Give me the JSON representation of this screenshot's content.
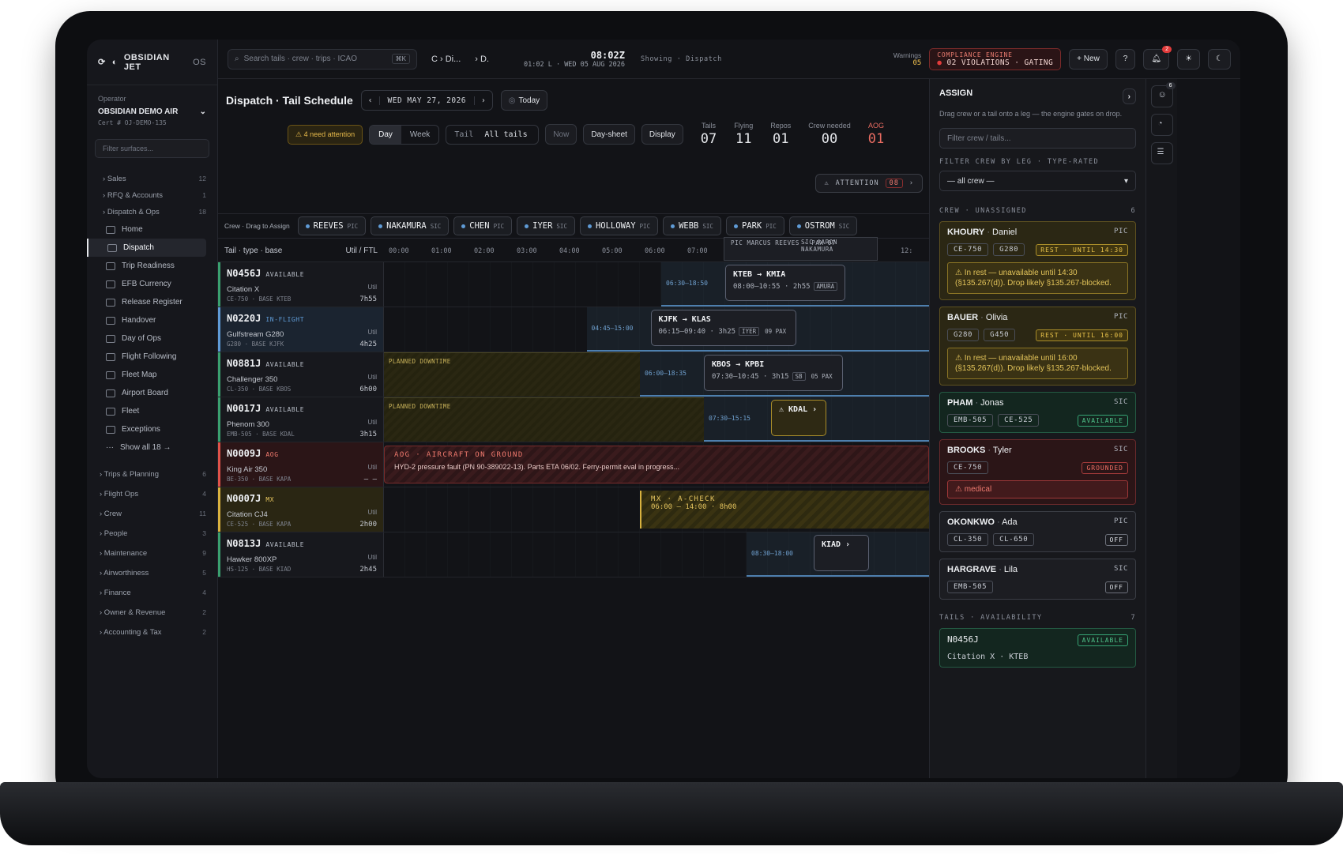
{
  "brand": {
    "name": "OBSIDIAN JET",
    "os": "OS"
  },
  "operator": {
    "label": "Operator",
    "name": "OBSIDIAN DEMO AIR",
    "cert": "Cert # OJ-DEMO-135"
  },
  "sidebar": {
    "filter_placeholder": "Filter surfaces...",
    "groups_top": [
      {
        "label": "Sales",
        "count": "12"
      },
      {
        "label": "RFQ & Accounts",
        "count": "1"
      },
      {
        "label": "Dispatch & Ops",
        "count": "18"
      }
    ],
    "items": [
      {
        "label": "Home"
      },
      {
        "label": "Dispatch"
      },
      {
        "label": "Trip Readiness"
      },
      {
        "label": "EFB Currency"
      },
      {
        "label": "Release Register"
      },
      {
        "label": "Handover"
      },
      {
        "label": "Day of Ops"
      },
      {
        "label": "Flight Following"
      },
      {
        "label": "Fleet Map"
      },
      {
        "label": "Airport Board"
      },
      {
        "label": "Fleet"
      },
      {
        "label": "Exceptions"
      }
    ],
    "show_all": "Show all 18 →",
    "groups_bottom": [
      {
        "label": "Trips & Planning",
        "count": "6"
      },
      {
        "label": "Flight Ops",
        "count": "4"
      },
      {
        "label": "Crew",
        "count": "11"
      },
      {
        "label": "People",
        "count": "3"
      },
      {
        "label": "Maintenance",
        "count": "9"
      },
      {
        "label": "Airworthiness",
        "count": "5"
      },
      {
        "label": "Finance",
        "count": "4"
      },
      {
        "label": "Owner & Revenue",
        "count": "2"
      },
      {
        "label": "Accounting & Tax",
        "count": "2"
      }
    ]
  },
  "topbar": {
    "search_placeholder": "Search tails · crew · trips · ICAO",
    "kbd": "⌘K",
    "crumb1": "C › Di...",
    "crumb2": "› D.",
    "clock": "08:02Z",
    "clock_sub": "01:02 L · WED 05 AUG 2026",
    "showing": "Showing · Dispatch",
    "warnings_label": "Warnings",
    "warnings_count": "05",
    "compliance_label": "COMPLIANCE ENGINE",
    "compliance_value": "02 VIOLATIONS · GATING",
    "new_label": "+ New",
    "help_label": "?",
    "notif_count": "2"
  },
  "page": {
    "title": "Dispatch · Tail Schedule",
    "date": "WED MAY 27, 2026",
    "today": "Today",
    "need_attention": "⚠ 4 need attention",
    "view_day": "Day",
    "view_week": "Week",
    "tail_label": "Tail",
    "tail_value": "All tails",
    "now_btn": "Now",
    "daysheet_btn": "Day-sheet",
    "display_btn": "Display",
    "attention_label": "ATTENTION",
    "attention_count": "08"
  },
  "stats": [
    {
      "label": "Tails",
      "value": "07"
    },
    {
      "label": "Flying",
      "value": "11"
    },
    {
      "label": "Repos",
      "value": "01"
    },
    {
      "label": "Crew needed",
      "value": "00"
    },
    {
      "label": "AOG",
      "value": "01"
    }
  ],
  "crew_bar": {
    "label": "Crew · Drag to Assign",
    "chips": [
      {
        "name": "REEVES",
        "role": "PIC"
      },
      {
        "name": "NAKAMURA",
        "role": "SIC"
      },
      {
        "name": "CHEN",
        "role": "PIC"
      },
      {
        "name": "IYER",
        "role": "SIC"
      },
      {
        "name": "HOLLOWAY",
        "role": "PIC"
      },
      {
        "name": "WEBB",
        "role": "SIC"
      },
      {
        "name": "PARK",
        "role": "PIC"
      },
      {
        "name": "OSTROM",
        "role": "SIC"
      }
    ]
  },
  "grid": {
    "tail_header": "Tail · type · base",
    "util_header": "Util / FTL",
    "hours": [
      "00:00",
      "01:00",
      "02:00",
      "03:00",
      "04:00",
      "05:00",
      "06:00",
      "07:00",
      "",
      "",
      "",
      "",
      "12:"
    ],
    "float_pic": "PIC MARCUS REEVES · PAX 07",
    "float_sic": "SIC AARON NAKAMURA",
    "rows": [
      {
        "reg": "N0456J",
        "status": "AVAILABLE",
        "type": "Citation X",
        "meta": "CE-750 · BASE KTEB",
        "util": "7h55",
        "window": "06:30–18:50",
        "leg_route": "KTEB → KMIA",
        "leg_time": "08:00–10:55 · 2h55",
        "leg_tag": "AMURA"
      },
      {
        "reg": "N0220J",
        "status": "IN-FLIGHT",
        "type": "Gulfstream G280",
        "meta": "G280 · BASE KJFK",
        "util": "4h25",
        "window": "04:45–15:00",
        "leg_route": "KJFK → KLAS",
        "leg_time": "06:15–09:40 · 3h25",
        "leg_tag": "IYER",
        "leg_pax": "09 PAX"
      },
      {
        "reg": "N0881J",
        "status": "AVAILABLE",
        "type": "Challenger 350",
        "meta": "CL-350 · BASE KBOS",
        "util": "6h00",
        "down": "PLANNED DOWNTIME",
        "window": "06:00–18:35",
        "leg_route": "KBOS → KPBI",
        "leg_time": "07:30–10:45 · 3h15",
        "leg_tag": "SB",
        "leg_pax": "05 PAX"
      },
      {
        "reg": "N0017J",
        "status": "AVAILABLE",
        "type": "Phenom 300",
        "meta": "EMB-505 · BASE KDAL",
        "util": "3h15",
        "down": "PLANNED DOWNTIME",
        "window": "07:30–15:15",
        "leg_route": "⚠ KDAL ›"
      },
      {
        "reg": "N0009J",
        "status": "AOG",
        "type": "King Air 350",
        "meta": "BE-350 · BASE KAPA",
        "util": "– –",
        "aog_title": "AOG · AIRCRAFT ON GROUND",
        "aog_text": "HYD-2 pressure fault (PN 90-389022-13). Parts ETA 06/02. Ferry-permit eval in progress..."
      },
      {
        "reg": "N0007J",
        "status": "MX",
        "type": "Citation CJ4",
        "meta": "CE-525 · BASE KAPA",
        "util": "2h00",
        "mx_title": "MX · A-CHECK",
        "mx_time": "06:00 – 14:00 · 8h00"
      },
      {
        "reg": "N0813J",
        "status": "AVAILABLE",
        "type": "Hawker 800XP",
        "meta": "HS-125 · BASE KIAD",
        "util": "2h45",
        "window": "08:30–18:00",
        "leg_route": "KIAD ›"
      }
    ]
  },
  "assign": {
    "title": "ASSIGN",
    "sub": "Drag crew or a tail onto a leg — the engine gates on drop.",
    "filter_placeholder": "Filter crew / tails...",
    "filter_by_leg": "FILTER CREW BY LEG · TYPE-RATED",
    "select_value": "— all crew —",
    "crew_section": "CREW · UNASSIGNED",
    "crew_count": "6",
    "crew": [
      {
        "last": "KHOURY",
        "first": "Daniel",
        "role": "PIC",
        "types": [
          "CE-750",
          "G280"
        ],
        "status": "REST · UNTIL 14:30",
        "note": "⚠ In rest — unavailable until 14:30 (§135.267(d)). Drop likely §135.267-blocked.",
        "tone": "yellow"
      },
      {
        "last": "BAUER",
        "first": "Olivia",
        "role": "PIC",
        "types": [
          "G280",
          "G450"
        ],
        "status": "REST · UNTIL 16:00",
        "note": "⚠ In rest — unavailable until 16:00 (§135.267(d)). Drop likely §135.267-blocked.",
        "tone": "yellow"
      },
      {
        "last": "PHAM",
        "first": "Jonas",
        "role": "SIC",
        "types": [
          "EMB-505",
          "CE-525"
        ],
        "status": "AVAILABLE",
        "tone": "green"
      },
      {
        "last": "BROOKS",
        "first": "Tyler",
        "role": "SIC",
        "types": [
          "CE-750"
        ],
        "status": "GROUNDED",
        "note": "⚠ medical",
        "tone": "red"
      },
      {
        "last": "OKONKWO",
        "first": "Ada",
        "role": "PIC",
        "types": [
          "CL-350",
          "CL-650"
        ],
        "status": "OFF",
        "tone": "neutral"
      },
      {
        "last": "HARGRAVE",
        "first": "Lila",
        "role": "SIC",
        "types": [
          "EMB-505"
        ],
        "status": "OFF",
        "tone": "neutral"
      }
    ],
    "tails_section": "TAILS · AVAILABILITY",
    "tails_count": "7",
    "tail_card": {
      "reg": "N0456J",
      "status": "AVAILABLE",
      "sub": "Citation X · KTEB"
    }
  },
  "rail": {
    "people_count": "6"
  },
  "colors": {
    "accent_blue": "#5f9bd6",
    "aog_red": "#f17a6e",
    "warn_amber": "#e6b94a",
    "ok_green": "#4fc28a"
  }
}
